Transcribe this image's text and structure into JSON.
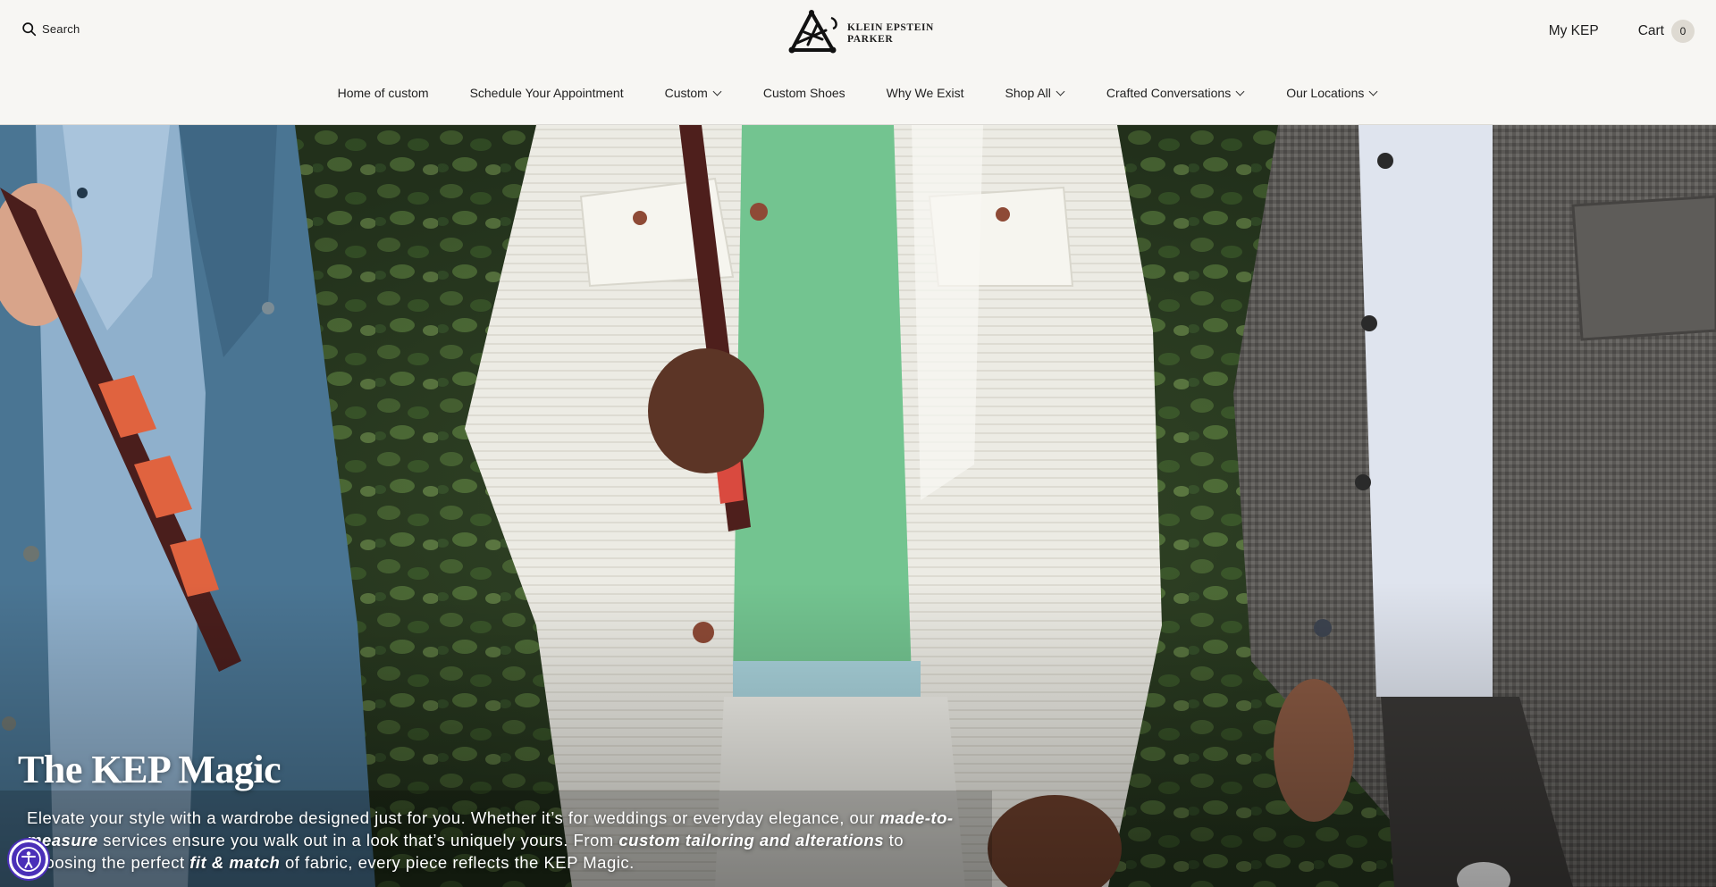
{
  "header": {
    "search_label": "Search",
    "logo_line1": "KLEIN EPSTEIN",
    "logo_line2": "PARKER",
    "account_label": "My KEP",
    "cart_label": "Cart",
    "cart_count": "0"
  },
  "nav": {
    "items": [
      {
        "label": "Home of custom",
        "has_dropdown": false
      },
      {
        "label": "Schedule Your Appointment",
        "has_dropdown": false
      },
      {
        "label": "Custom",
        "has_dropdown": true
      },
      {
        "label": "Custom Shoes",
        "has_dropdown": false
      },
      {
        "label": "Why We Exist",
        "has_dropdown": false
      },
      {
        "label": "Shop All",
        "has_dropdown": true
      },
      {
        "label": "Crafted Conversations",
        "has_dropdown": true
      },
      {
        "label": "Our Locations",
        "has_dropdown": true
      }
    ]
  },
  "hero": {
    "title": "The KEP Magic",
    "copy_1": "Elevate your style with a wardrobe designed just for you. Whether it’s for weddings or everyday elegance, our ",
    "copy_em_1": "made-to-measure",
    "copy_2": " services ensure you walk out in a look that’s uniquely yours. From ",
    "copy_em_2": "custom tailoring and alterations",
    "copy_3": " to choosing the perfect ",
    "copy_em_3": "fit & match",
    "copy_4": " of fabric, every piece reflects the KEP Magic."
  },
  "colors": {
    "header_bg": "#f7f6f3",
    "text": "#1e1e1e",
    "cart_badge": "#dedad2",
    "accessibility_button": "#4a2fb8"
  },
  "icons": {
    "search": "search-icon",
    "logo": "kep-triangle-logo",
    "dropdown": "chevron-down-icon",
    "accessibility": "accessibility-icon"
  }
}
